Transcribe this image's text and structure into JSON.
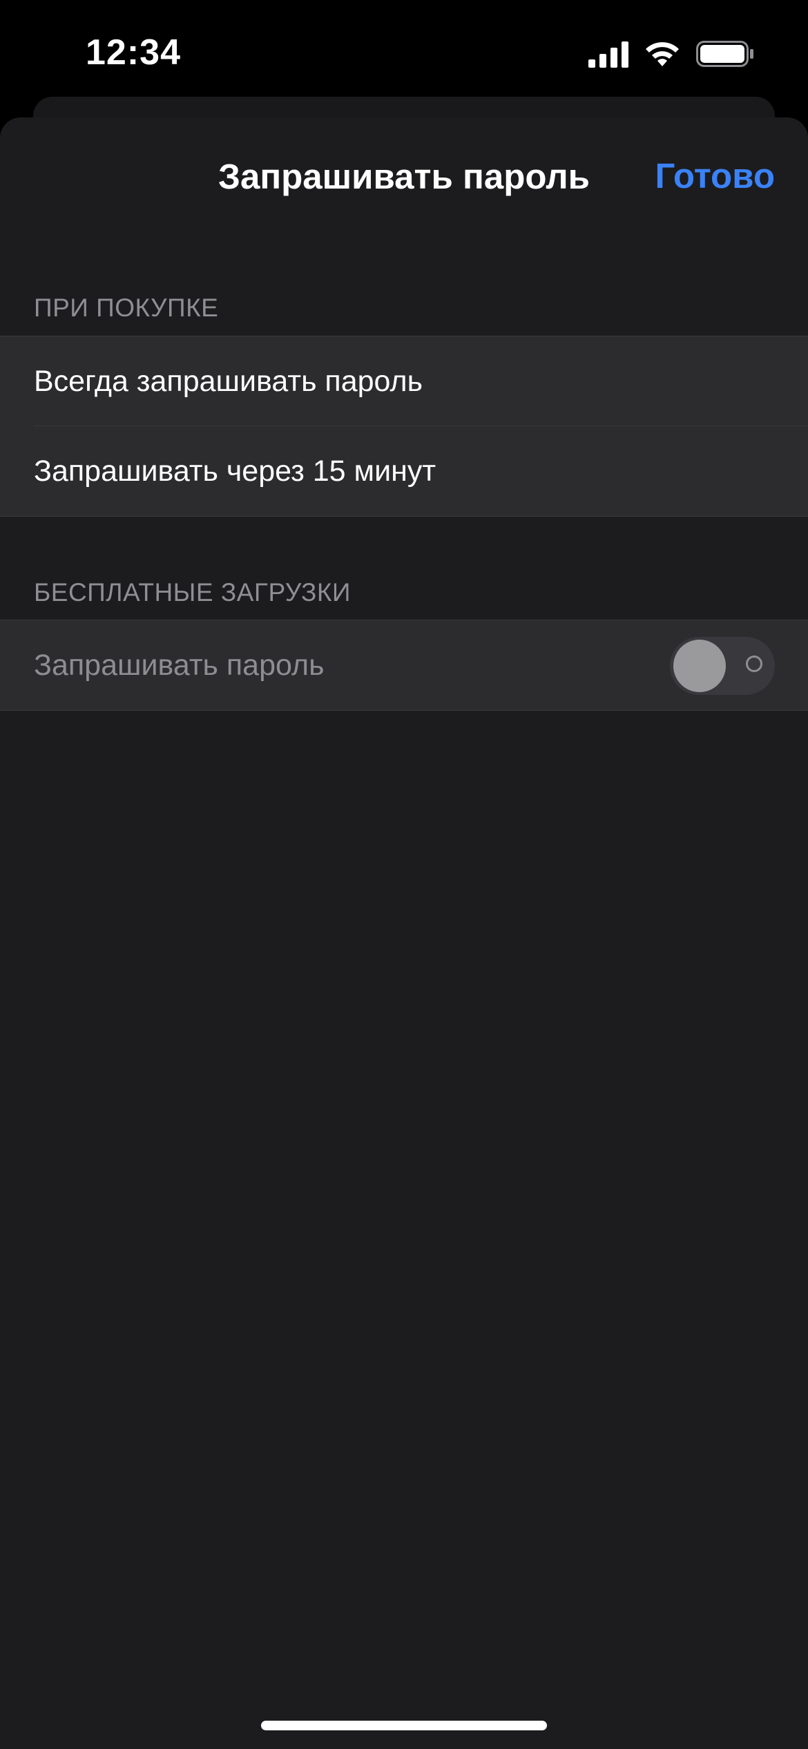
{
  "status_bar": {
    "time": "12:34",
    "icons": [
      "signal-icon",
      "wifi-icon",
      "battery-icon"
    ]
  },
  "nav": {
    "title": "Запрашивать пароль",
    "done_label": "Готово"
  },
  "sections": [
    {
      "header": "ПРИ ПОКУПКЕ",
      "items": [
        {
          "label": "Всегда запрашивать пароль"
        },
        {
          "label": "Запрашивать через 15 минут"
        }
      ]
    },
    {
      "header": "БЕСПЛАТНЫЕ ЗАГРУЗКИ",
      "items": [
        {
          "label": "Запрашивать пароль",
          "toggle": false,
          "disabled": true
        }
      ]
    }
  ],
  "colors": {
    "background": "#1c1c1e",
    "cell": "#2c2c2e",
    "accent": "#3a82f7",
    "secondary_text": "#8e8e93"
  }
}
